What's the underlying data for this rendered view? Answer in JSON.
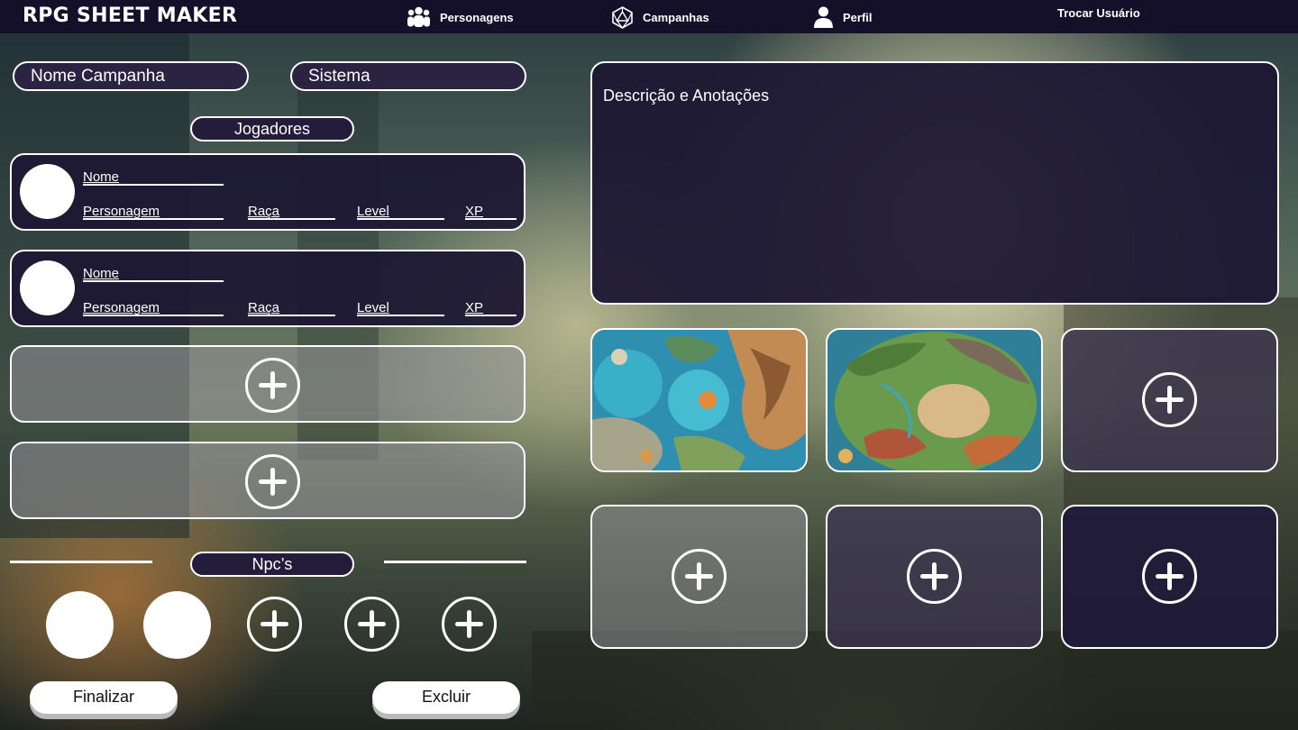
{
  "app": {
    "brand": "RPG SHEET MAKER"
  },
  "nav": {
    "characters": "Personagens",
    "campaigns": "Campanhas",
    "profile": "Perfil",
    "switch_user": "Trocar Usuário"
  },
  "campaign": {
    "name_placeholder": "Nome Campanha",
    "system_placeholder": "Sistema",
    "description_placeholder": "Descrição e Anotações"
  },
  "players": {
    "section_label": "Jogadores",
    "cards": [
      {
        "name_label": "Nome",
        "character_label": "Personagem",
        "race_label": "Raça",
        "level_label": "Level",
        "xp_label": "XP"
      },
      {
        "name_label": "Nome",
        "character_label": "Personagem",
        "race_label": "Raça",
        "level_label": "Level",
        "xp_label": "XP"
      }
    ]
  },
  "npcs": {
    "section_label": "Npc’s"
  },
  "actions": {
    "finish": "Finalizar",
    "delete": "Excluir"
  },
  "icons": {
    "characters": "group-icon",
    "campaigns": "d20-dice-icon",
    "profile": "user-icon",
    "add": "plus-icon"
  },
  "colors": {
    "nav_bg": "#141029",
    "panel_bg": "#1e1834",
    "empty_slot": "#96969b"
  }
}
